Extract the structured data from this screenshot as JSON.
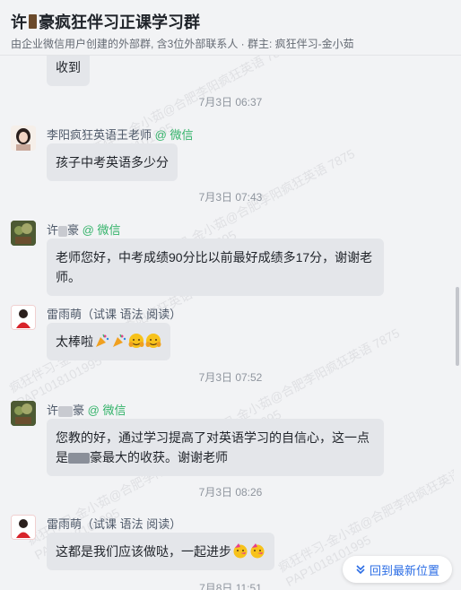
{
  "header": {
    "title_prefix": "许",
    "title_suffix": "豪疯狂伴习正课学习群",
    "subtitle": "由企业微信用户创建的外部群, 含3位外部联系人 · 群主: 疯狂伴习-金小茹"
  },
  "watermark": {
    "lines": [
      "疯狂伴习-金小茹@合肥李阳疯狂英语 7875",
      "PAP1018101995"
    ]
  },
  "messages": [
    {
      "type": "bubble_only",
      "text": "收到"
    },
    {
      "type": "time",
      "text": "7月3日 06:37"
    },
    {
      "type": "msg",
      "sender": "李阳疯狂英语王老师",
      "tag": "@ 微信",
      "text": "孩子中考英语多少分"
    },
    {
      "type": "time",
      "text": "7月3日 07:43"
    },
    {
      "type": "msg",
      "sender_prefix": "许",
      "sender_suffix": "豪",
      "tag": "@ 微信",
      "text": "老师您好，中考成绩90分比以前最好成绩多17分，谢谢老师。"
    },
    {
      "type": "msg",
      "sender": "雷雨萌（试课 语法 阅读）",
      "text": "太棒啦"
    },
    {
      "type": "time",
      "text": "7月3日 07:52"
    },
    {
      "type": "msg",
      "sender_prefix": "许",
      "sender_suffix": "豪",
      "tag": "@ 微信",
      "text_line1": "您教的好，通过学习提高了对英语学习的自信心，这一点",
      "text_line2_prefix": "是",
      "text_line2_suffix": "豪最大的收获。谢谢老师"
    },
    {
      "type": "time",
      "text": "7月3日 08:26"
    },
    {
      "type": "msg",
      "sender": "雷雨萌（试课 语法 阅读）",
      "text": "这都是我们应该做哒，一起进步"
    },
    {
      "type": "time",
      "text": "7月8日 11:51"
    }
  ],
  "jump_button": {
    "label": "回到最新位置",
    "icon": "double-chevron-down-icon"
  }
}
